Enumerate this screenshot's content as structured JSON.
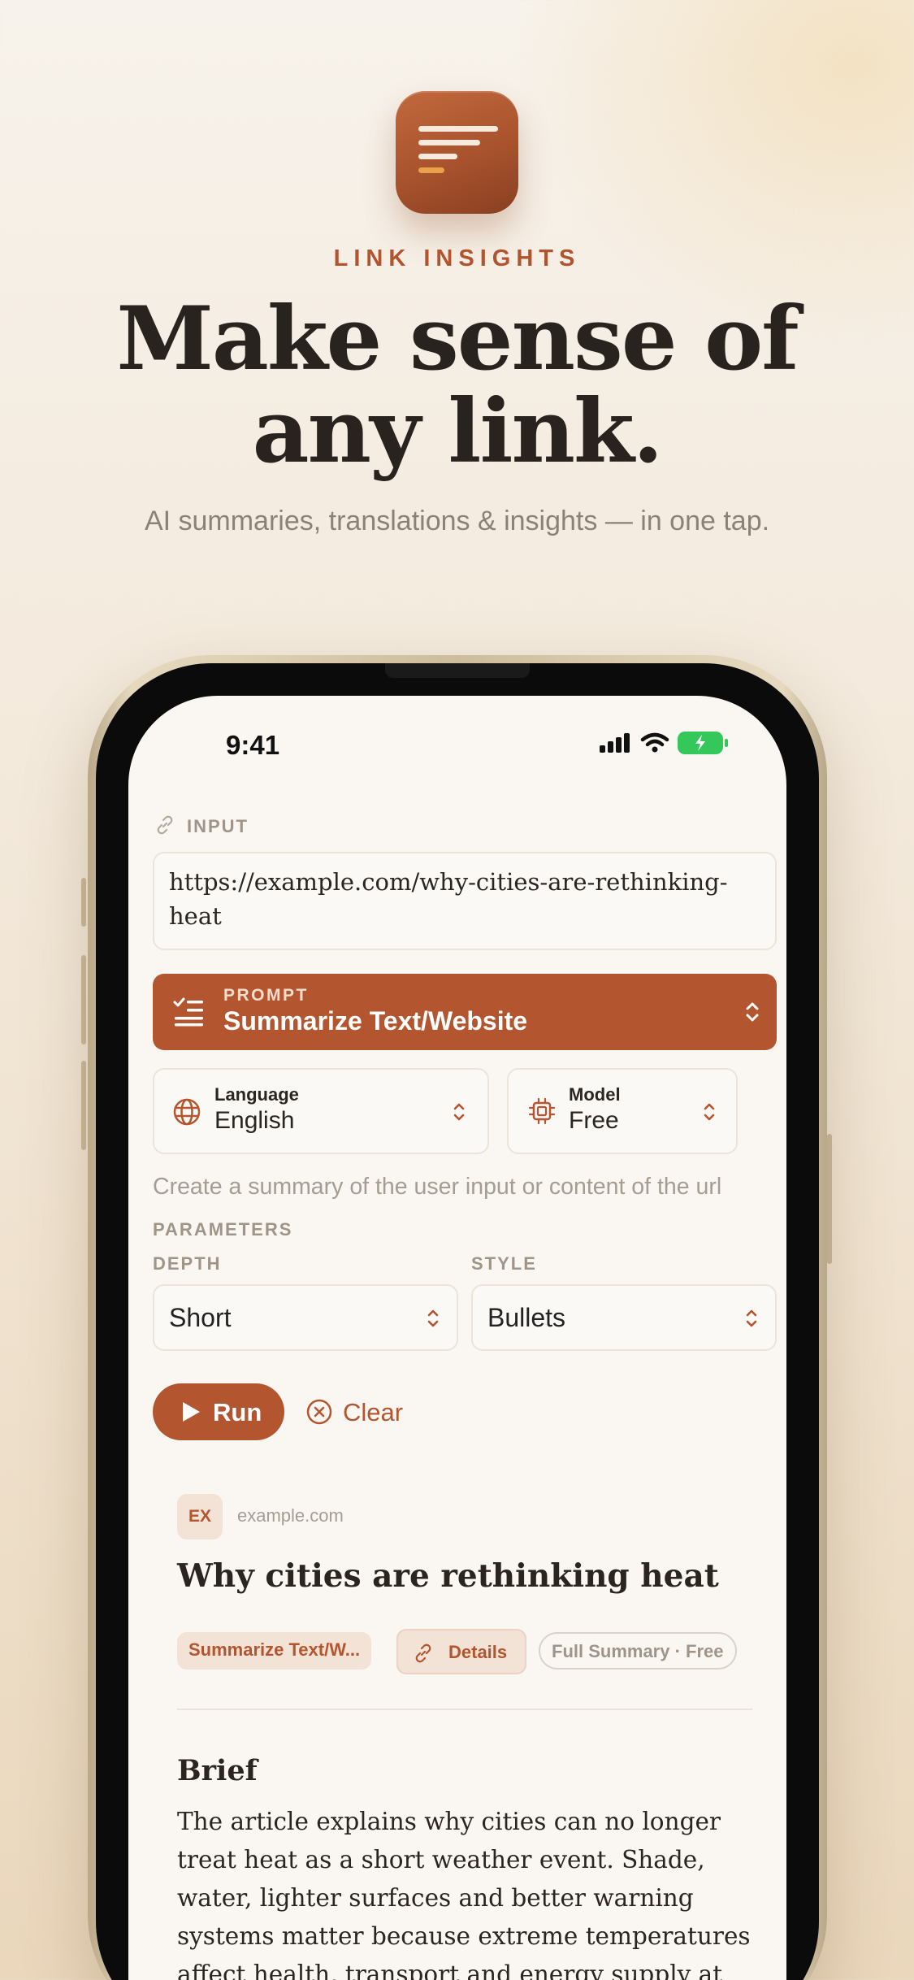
{
  "hero": {
    "eyebrow": "LINK INSIGHTS",
    "headline_line1": "Make sense of",
    "headline_line2": "any link.",
    "subline": "AI summaries, translations & insights — in one tap."
  },
  "status_bar": {
    "time": "9:41"
  },
  "input": {
    "label": "INPUT",
    "url_value": "https://example.com/why-cities-are-rethinking-heat"
  },
  "prompt": {
    "label": "PROMPT",
    "value": "Summarize Text/Website"
  },
  "language": {
    "label": "Language",
    "value": "English"
  },
  "model": {
    "label": "Model",
    "value": "Free"
  },
  "description": "Create a summary of the user input or content of the url",
  "parameters": {
    "label": "PARAMETERS",
    "depth": {
      "label": "DEPTH",
      "value": "Short"
    },
    "style": {
      "label": "STYLE",
      "value": "Bullets"
    }
  },
  "actions": {
    "run": "Run",
    "clear": "Clear"
  },
  "result": {
    "favicon": "EX",
    "domain": "example.com",
    "title": "Why cities are rethinking heat",
    "chips": {
      "prompt": "Summarize Text/W...",
      "details": "Details",
      "meta": "Full Summary · Free"
    },
    "section_title": "Brief",
    "body": "The article explains why cities can no longer treat heat as a short weather event. Shade, water, lighter surfaces and better warning systems matter because extreme temperatures affect health, transport and energy supply at"
  },
  "colors": {
    "accent": "#b3552f",
    "accent_light": "#f3e2d6",
    "background": "#faf7f2"
  },
  "icons": [
    "link-icon",
    "checklist-icon",
    "chevron-updown-icon",
    "globe-icon",
    "chip-icon",
    "play-icon",
    "close-circle-icon",
    "wifi-icon",
    "cellular-icon",
    "battery-icon"
  ]
}
